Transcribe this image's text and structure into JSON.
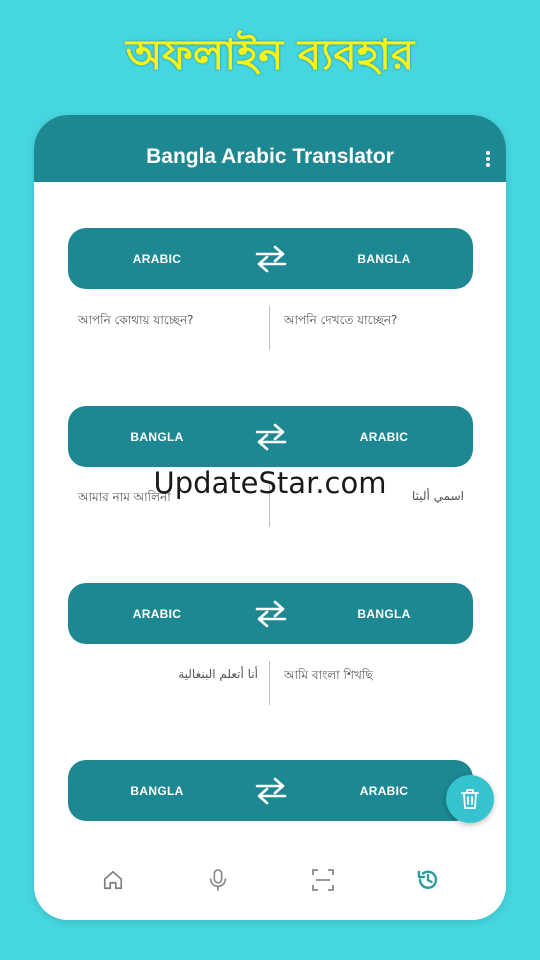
{
  "banner": {
    "text": "অফলাইন ব্যবহার"
  },
  "app": {
    "title": "Bangla Arabic Translator"
  },
  "colors": {
    "background": "#45d6df",
    "primary": "#1d8892",
    "accent": "#36c3cf",
    "banner_text": "#f6f21a"
  },
  "cards": [
    {
      "from": "ARABIC",
      "to": "BANGLA",
      "source_text": "আপনি কোথায় যাচ্ছেন?",
      "translated_text": "আপনি দেখতে যাচ্ছেন?"
    },
    {
      "from": "BANGLA",
      "to": "ARABIC",
      "source_text": "আমার নাম আলিনা",
      "translated_text": "اسمي أليثا"
    },
    {
      "from": "ARABIC",
      "to": "BANGLA",
      "source_text": "أنا أتعلم البنغالية",
      "translated_text": "আমি বাংলা শিখছি"
    },
    {
      "from": "BANGLA",
      "to": "ARABIC"
    }
  ],
  "watermark": {
    "text": "UpdateStar.com"
  },
  "icons": {
    "menu": "more-vert-icon",
    "swap": "swap-arrows-icon",
    "delete": "trash-icon",
    "nav": [
      "home-icon",
      "microphone-icon",
      "scan-icon",
      "history-icon"
    ]
  }
}
